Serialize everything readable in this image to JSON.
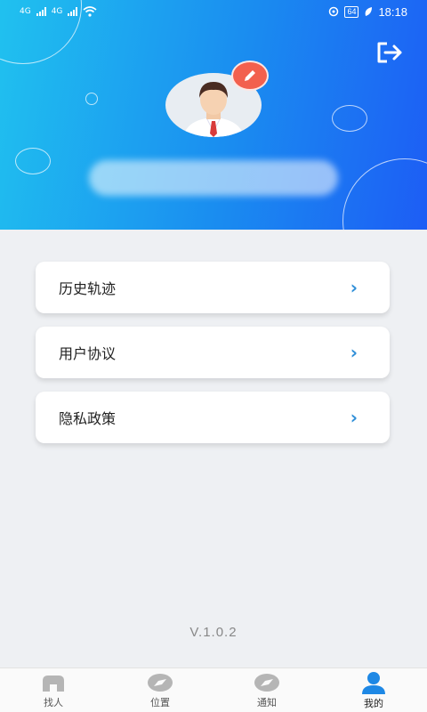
{
  "status_bar": {
    "time": "18:18",
    "battery": "64",
    "network_1": "4G",
    "network_2": "4G"
  },
  "profile": {
    "avatar_alt": "user avatar",
    "edit_icon": "pencil-icon",
    "logout_icon": "logout-icon"
  },
  "menu": {
    "items": [
      {
        "label": "历史轨迹"
      },
      {
        "label": "用户协议"
      },
      {
        "label": "隐私政策"
      }
    ]
  },
  "version": "V.1.0.2",
  "tabbar": {
    "tabs": [
      {
        "label": "找人",
        "icon": "home-icon"
      },
      {
        "label": "位置",
        "icon": "compass-icon"
      },
      {
        "label": "通知",
        "icon": "compass-icon"
      },
      {
        "label": "我的",
        "icon": "user-icon"
      }
    ],
    "active_index": 3
  },
  "colors": {
    "accent": "#1a8cf0",
    "edit": "#f2604e",
    "chevron": "#2f8fd8",
    "active_tab": "#1e88e5"
  }
}
